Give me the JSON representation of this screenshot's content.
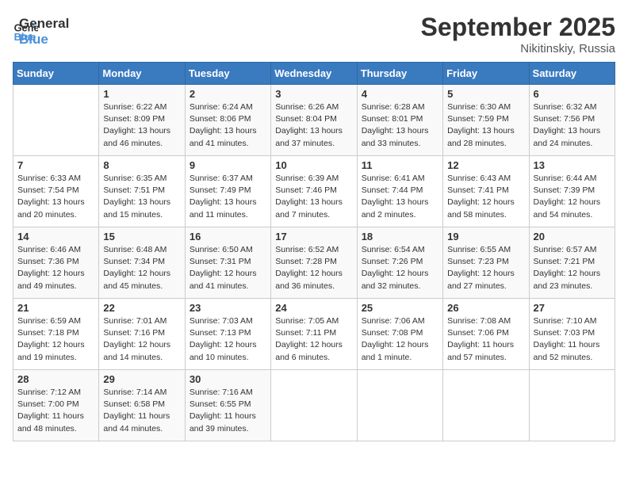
{
  "header": {
    "logo_line1": "General",
    "logo_line2": "Blue",
    "month_title": "September 2025",
    "location": "Nikitinskiy, Russia"
  },
  "days_of_week": [
    "Sunday",
    "Monday",
    "Tuesday",
    "Wednesday",
    "Thursday",
    "Friday",
    "Saturday"
  ],
  "weeks": [
    [
      {
        "day": "",
        "info": ""
      },
      {
        "day": "1",
        "info": "Sunrise: 6:22 AM\nSunset: 8:09 PM\nDaylight: 13 hours\nand 46 minutes."
      },
      {
        "day": "2",
        "info": "Sunrise: 6:24 AM\nSunset: 8:06 PM\nDaylight: 13 hours\nand 41 minutes."
      },
      {
        "day": "3",
        "info": "Sunrise: 6:26 AM\nSunset: 8:04 PM\nDaylight: 13 hours\nand 37 minutes."
      },
      {
        "day": "4",
        "info": "Sunrise: 6:28 AM\nSunset: 8:01 PM\nDaylight: 13 hours\nand 33 minutes."
      },
      {
        "day": "5",
        "info": "Sunrise: 6:30 AM\nSunset: 7:59 PM\nDaylight: 13 hours\nand 28 minutes."
      },
      {
        "day": "6",
        "info": "Sunrise: 6:32 AM\nSunset: 7:56 PM\nDaylight: 13 hours\nand 24 minutes."
      }
    ],
    [
      {
        "day": "7",
        "info": "Sunrise: 6:33 AM\nSunset: 7:54 PM\nDaylight: 13 hours\nand 20 minutes."
      },
      {
        "day": "8",
        "info": "Sunrise: 6:35 AM\nSunset: 7:51 PM\nDaylight: 13 hours\nand 15 minutes."
      },
      {
        "day": "9",
        "info": "Sunrise: 6:37 AM\nSunset: 7:49 PM\nDaylight: 13 hours\nand 11 minutes."
      },
      {
        "day": "10",
        "info": "Sunrise: 6:39 AM\nSunset: 7:46 PM\nDaylight: 13 hours\nand 7 minutes."
      },
      {
        "day": "11",
        "info": "Sunrise: 6:41 AM\nSunset: 7:44 PM\nDaylight: 13 hours\nand 2 minutes."
      },
      {
        "day": "12",
        "info": "Sunrise: 6:43 AM\nSunset: 7:41 PM\nDaylight: 12 hours\nand 58 minutes."
      },
      {
        "day": "13",
        "info": "Sunrise: 6:44 AM\nSunset: 7:39 PM\nDaylight: 12 hours\nand 54 minutes."
      }
    ],
    [
      {
        "day": "14",
        "info": "Sunrise: 6:46 AM\nSunset: 7:36 PM\nDaylight: 12 hours\nand 49 minutes."
      },
      {
        "day": "15",
        "info": "Sunrise: 6:48 AM\nSunset: 7:34 PM\nDaylight: 12 hours\nand 45 minutes."
      },
      {
        "day": "16",
        "info": "Sunrise: 6:50 AM\nSunset: 7:31 PM\nDaylight: 12 hours\nand 41 minutes."
      },
      {
        "day": "17",
        "info": "Sunrise: 6:52 AM\nSunset: 7:28 PM\nDaylight: 12 hours\nand 36 minutes."
      },
      {
        "day": "18",
        "info": "Sunrise: 6:54 AM\nSunset: 7:26 PM\nDaylight: 12 hours\nand 32 minutes."
      },
      {
        "day": "19",
        "info": "Sunrise: 6:55 AM\nSunset: 7:23 PM\nDaylight: 12 hours\nand 27 minutes."
      },
      {
        "day": "20",
        "info": "Sunrise: 6:57 AM\nSunset: 7:21 PM\nDaylight: 12 hours\nand 23 minutes."
      }
    ],
    [
      {
        "day": "21",
        "info": "Sunrise: 6:59 AM\nSunset: 7:18 PM\nDaylight: 12 hours\nand 19 minutes."
      },
      {
        "day": "22",
        "info": "Sunrise: 7:01 AM\nSunset: 7:16 PM\nDaylight: 12 hours\nand 14 minutes."
      },
      {
        "day": "23",
        "info": "Sunrise: 7:03 AM\nSunset: 7:13 PM\nDaylight: 12 hours\nand 10 minutes."
      },
      {
        "day": "24",
        "info": "Sunrise: 7:05 AM\nSunset: 7:11 PM\nDaylight: 12 hours\nand 6 minutes."
      },
      {
        "day": "25",
        "info": "Sunrise: 7:06 AM\nSunset: 7:08 PM\nDaylight: 12 hours\nand 1 minute."
      },
      {
        "day": "26",
        "info": "Sunrise: 7:08 AM\nSunset: 7:06 PM\nDaylight: 11 hours\nand 57 minutes."
      },
      {
        "day": "27",
        "info": "Sunrise: 7:10 AM\nSunset: 7:03 PM\nDaylight: 11 hours\nand 52 minutes."
      }
    ],
    [
      {
        "day": "28",
        "info": "Sunrise: 7:12 AM\nSunset: 7:00 PM\nDaylight: 11 hours\nand 48 minutes."
      },
      {
        "day": "29",
        "info": "Sunrise: 7:14 AM\nSunset: 6:58 PM\nDaylight: 11 hours\nand 44 minutes."
      },
      {
        "day": "30",
        "info": "Sunrise: 7:16 AM\nSunset: 6:55 PM\nDaylight: 11 hours\nand 39 minutes."
      },
      {
        "day": "",
        "info": ""
      },
      {
        "day": "",
        "info": ""
      },
      {
        "day": "",
        "info": ""
      },
      {
        "day": "",
        "info": ""
      }
    ]
  ]
}
